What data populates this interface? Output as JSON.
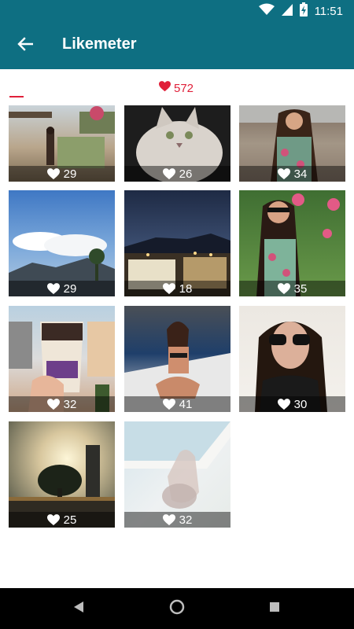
{
  "status_bar": {
    "time": "11:51",
    "icons": [
      "wifi-icon",
      "cell-signal-icon",
      "battery-charging-icon"
    ]
  },
  "app_bar": {
    "title": "Likemeter",
    "back_icon": "arrow-left-icon"
  },
  "summary": {
    "total_likes": "572",
    "icon": "heart-icon"
  },
  "photos": [
    {
      "likes": "29"
    },
    {
      "likes": "26"
    },
    {
      "likes": "34"
    },
    {
      "likes": "29"
    },
    {
      "likes": "18"
    },
    {
      "likes": "35"
    },
    {
      "likes": "32"
    },
    {
      "likes": "41"
    },
    {
      "likes": "30"
    },
    {
      "likes": "25"
    },
    {
      "likes": "32"
    }
  ],
  "nav_bar": {
    "back": "back-triangle-icon",
    "home": "home-circle-icon",
    "recents": "recents-square-icon"
  },
  "colors": {
    "primary": "#0e6f82",
    "accent": "#e0203a"
  }
}
